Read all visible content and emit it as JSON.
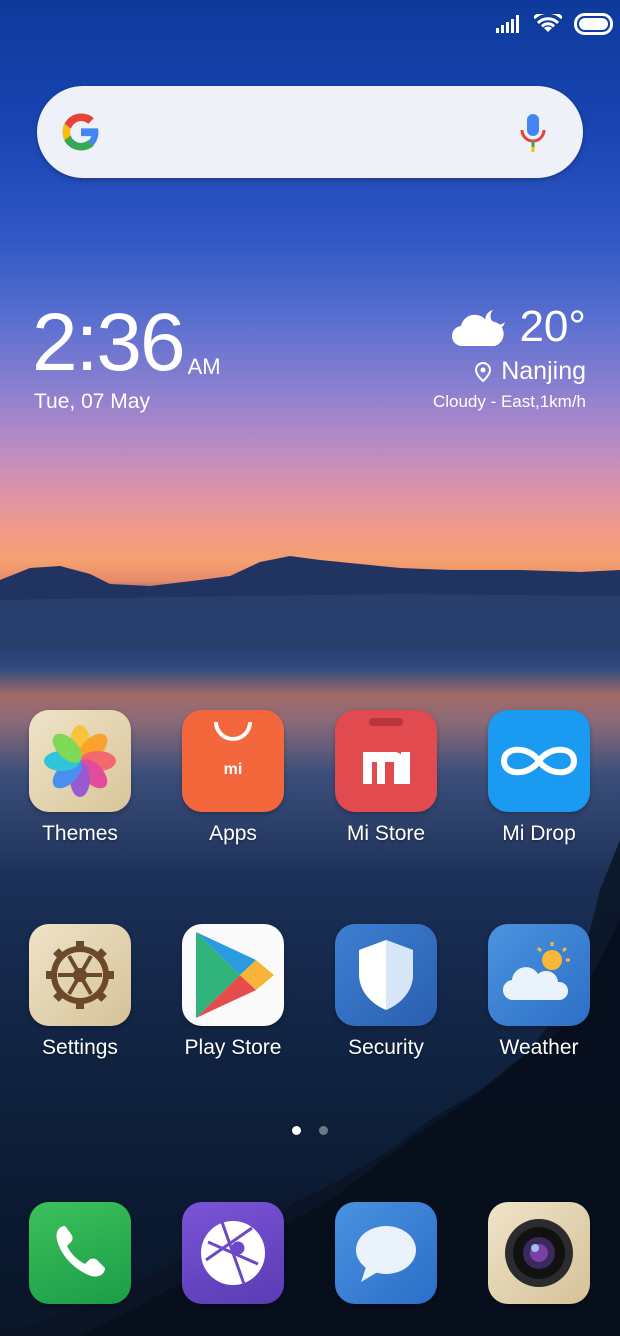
{
  "status_bar": {
    "icons": [
      "signal-icon",
      "wifi-icon",
      "battery-icon"
    ]
  },
  "search_bar": {
    "logo": "google-logo-icon",
    "mic": "mic-icon"
  },
  "clock_widget": {
    "time": "2:36",
    "ampm": "AM",
    "date": "Tue, 07 May"
  },
  "weather_widget": {
    "temperature": "20°",
    "city": "Nanjing",
    "description": "Cloudy - East,1km/h",
    "icon": "cloudy-night-icon"
  },
  "apps_row1": [
    {
      "label": "Themes",
      "icon": "themes-icon"
    },
    {
      "label": "Apps",
      "icon": "apps-icon"
    },
    {
      "label": "Mi Store",
      "icon": "mi-store-icon"
    },
    {
      "label": "Mi Drop",
      "icon": "mi-drop-icon"
    }
  ],
  "apps_row2": [
    {
      "label": "Settings",
      "icon": "settings-icon"
    },
    {
      "label": "Play Store",
      "icon": "play-store-icon"
    },
    {
      "label": "Security",
      "icon": "security-icon"
    },
    {
      "label": "Weather",
      "icon": "weather-icon"
    }
  ],
  "page_indicator": {
    "pages": 2,
    "current": 1
  },
  "dock": [
    {
      "icon": "phone-icon"
    },
    {
      "icon": "browser-icon"
    },
    {
      "icon": "messaging-icon"
    },
    {
      "icon": "camera-icon"
    }
  ]
}
